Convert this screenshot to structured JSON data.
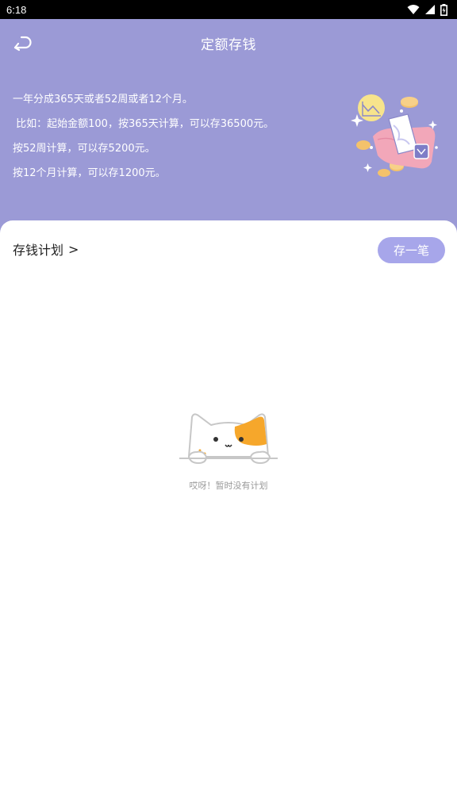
{
  "status_bar": {
    "time": "6:18",
    "icons": [
      "wifi-icon",
      "signal-icon",
      "battery-icon"
    ]
  },
  "header": {
    "title": "定额存钱",
    "back_icon": "back-arrow-icon",
    "background_color": "#9b9ad6",
    "description_lines": [
      "一年分成365天或者52周或者12个月。",
      " 比如：起始金额100，按365天计算，可以存36500元。",
      "按52周计算，可以存5200元。",
      "按12个月计算，可以存1200元。"
    ]
  },
  "plan_section": {
    "title": "存钱计划",
    "chevron": ">",
    "save_button": "存一笔",
    "save_button_color": "#a7a6ea"
  },
  "empty_state": {
    "icon": "sleepy-cat-icon",
    "message": "哎呀！暂时没有计划"
  }
}
